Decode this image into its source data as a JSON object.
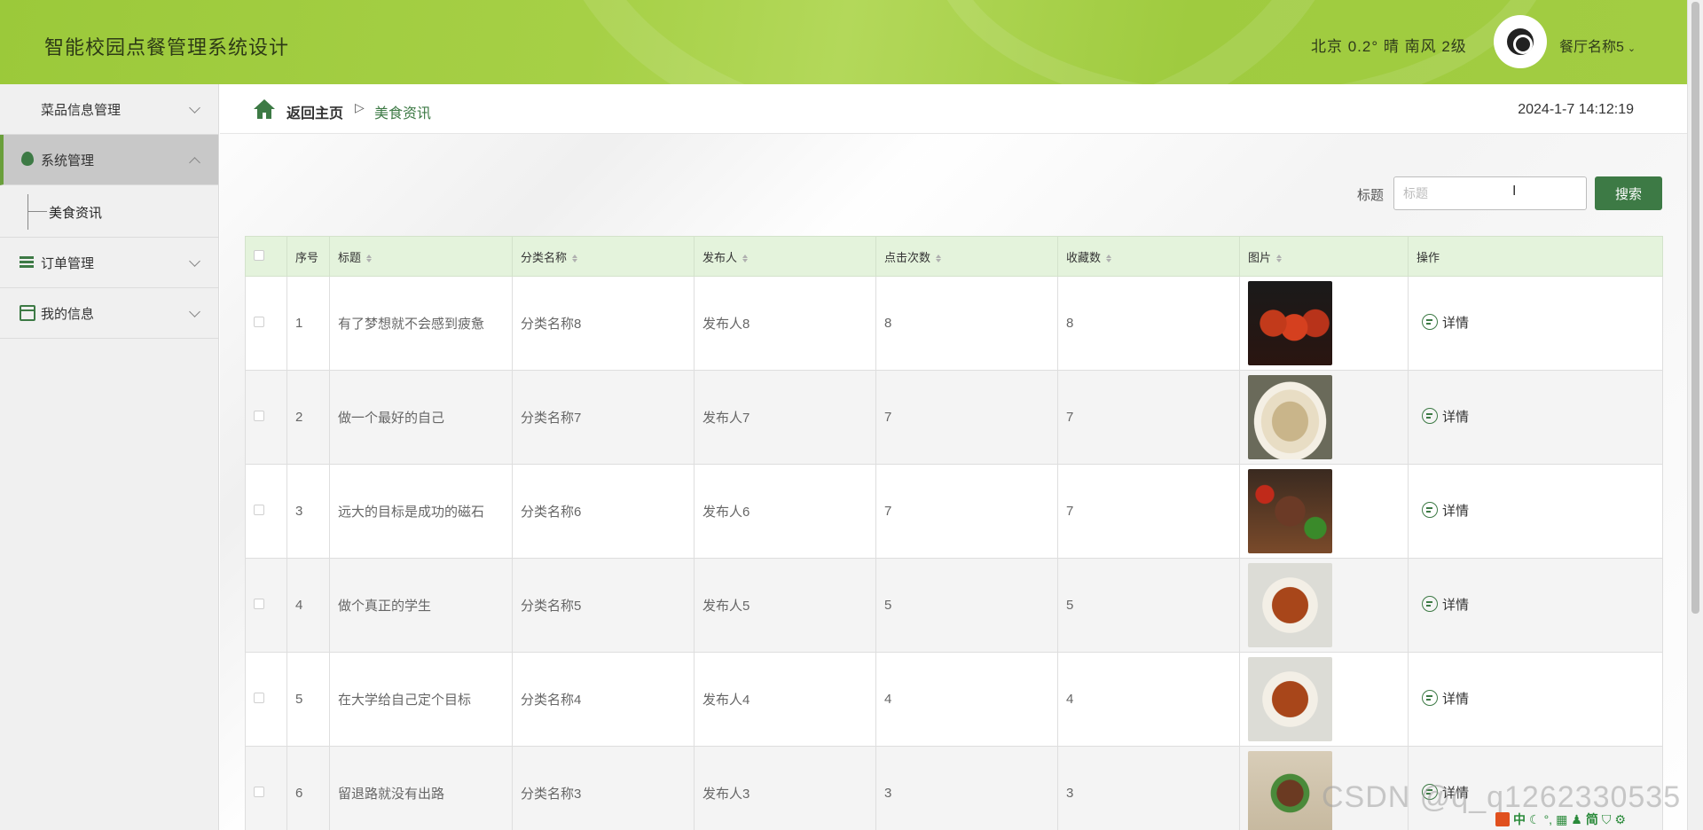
{
  "header": {
    "title": "智能校园点餐管理系统设计",
    "weather": "北京  0.2°  晴  南风  2级",
    "user_name": "餐厅名称5"
  },
  "sidebar": {
    "items": [
      {
        "label": "菜品信息管理"
      },
      {
        "label": "系统管理"
      },
      {
        "label": "订单管理"
      },
      {
        "label": "我的信息"
      }
    ],
    "submenu_item": "美食资讯"
  },
  "breadcrumb": {
    "home": "返回主页",
    "separator": "▷",
    "current": "美食资讯"
  },
  "datetime": "2024-1-7 14:12:19",
  "search": {
    "label": "标题",
    "placeholder": "标题",
    "button": "搜索"
  },
  "table": {
    "columns": [
      "序号",
      "标题",
      "分类名称",
      "发布人",
      "点击次数",
      "收藏数",
      "图片",
      "操作"
    ],
    "detail_label": "详情",
    "rows": [
      {
        "no": "1",
        "title": "有了梦想就不会感到疲惫",
        "category": "分类名称8",
        "publisher": "发布人8",
        "clicks": "8",
        "favorites": "8"
      },
      {
        "no": "2",
        "title": "做一个最好的自己",
        "category": "分类名称7",
        "publisher": "发布人7",
        "clicks": "7",
        "favorites": "7"
      },
      {
        "no": "3",
        "title": "远大的目标是成功的磁石",
        "category": "分类名称6",
        "publisher": "发布人6",
        "clicks": "7",
        "favorites": "7"
      },
      {
        "no": "4",
        "title": "做个真正的学生",
        "category": "分类名称5",
        "publisher": "发布人5",
        "clicks": "5",
        "favorites": "5"
      },
      {
        "no": "5",
        "title": "在大学给自己定个目标",
        "category": "分类名称4",
        "publisher": "发布人4",
        "clicks": "4",
        "favorites": "4"
      },
      {
        "no": "6",
        "title": "留退路就没有出路",
        "category": "分类名称3",
        "publisher": "发布人3",
        "clicks": "3",
        "favorites": "3"
      }
    ]
  },
  "watermark": "CSDN @q_q1262330535",
  "colors": {
    "header_green": "#a6d046",
    "primary_green": "#3d7a45",
    "table_header_bg": "#e4f3dc"
  }
}
